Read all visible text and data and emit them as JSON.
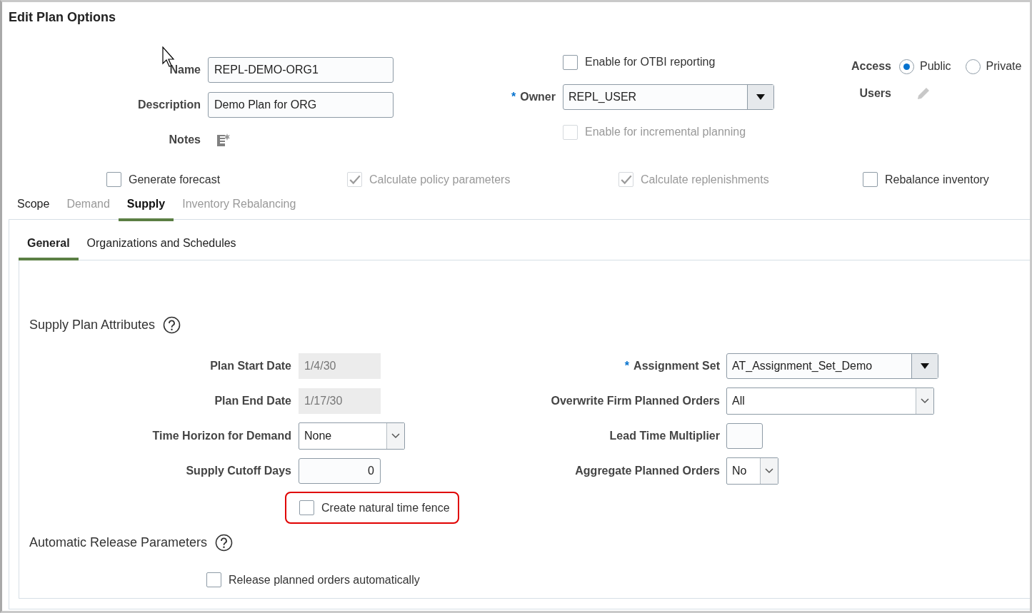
{
  "title": "Edit Plan Options",
  "header_fields": [
    {
      "label": "Name",
      "kind": "text",
      "value": "REPL-DEMO-ORG1"
    },
    {
      "label": "Description",
      "kind": "text",
      "value": "Demo Plan for ORG"
    },
    {
      "label": "Notes",
      "kind": "icon"
    }
  ],
  "otbi": {
    "label": "Enable for OTBI reporting",
    "checked": false,
    "disabled": false
  },
  "owner": {
    "label": "Owner",
    "required_mark": "*",
    "value": "REPL_USER"
  },
  "incremental": {
    "label": "Enable for incremental planning",
    "checked": false,
    "disabled": true
  },
  "access": {
    "label": "Access",
    "options": [
      {
        "label": "Public",
        "selected": true
      },
      {
        "label": "Private",
        "selected": false
      }
    ]
  },
  "users": {
    "label": "Users"
  },
  "options": [
    {
      "label": "Generate forecast",
      "checked": false,
      "disabled": false
    },
    {
      "label": "Calculate policy parameters",
      "checked": true,
      "disabled": true
    },
    {
      "label": "Calculate replenishments",
      "checked": true,
      "disabled": true
    },
    {
      "label": "Rebalance inventory",
      "checked": false,
      "disabled": false
    }
  ],
  "tabs": [
    {
      "label": "Scope",
      "selected": false,
      "disabled": false
    },
    {
      "label": "Demand",
      "selected": false,
      "disabled": true
    },
    {
      "label": "Supply",
      "selected": true,
      "disabled": false
    },
    {
      "label": "Inventory Rebalancing",
      "selected": false,
      "disabled": true
    }
  ],
  "subtabs": [
    {
      "label": "General",
      "selected": true
    },
    {
      "label": "Organizations and Schedules",
      "selected": false
    }
  ],
  "supply_attributes": {
    "title": "Supply Plan Attributes",
    "left_fields": [
      {
        "label": "Plan Start Date",
        "kind": "readonly",
        "value": "1/4/30"
      },
      {
        "label": "Plan End Date",
        "kind": "readonly",
        "value": "1/17/30"
      },
      {
        "label": "Time Horizon for Demand",
        "kind": "select",
        "value": "None"
      },
      {
        "label": "Supply Cutoff Days",
        "kind": "number",
        "value": "0"
      }
    ],
    "right_fields": [
      {
        "label": "Assignment Set",
        "required_mark": "*",
        "kind": "lov",
        "value": "AT_Assignment_Set_Demo"
      },
      {
        "label": "Overwrite Firm Planned Orders",
        "kind": "select",
        "value": "All"
      },
      {
        "label": "Lead Time Multiplier",
        "kind": "text"
      },
      {
        "label": "Aggregate Planned Orders",
        "kind": "select",
        "value": "No"
      }
    ],
    "natural_time_fence": {
      "label": "Create natural time fence",
      "checked": false,
      "highlighted": true
    }
  },
  "release": {
    "title": "Automatic Release Parameters",
    "checkbox": {
      "label": "Release planned orders automatically",
      "checked": false
    }
  }
}
